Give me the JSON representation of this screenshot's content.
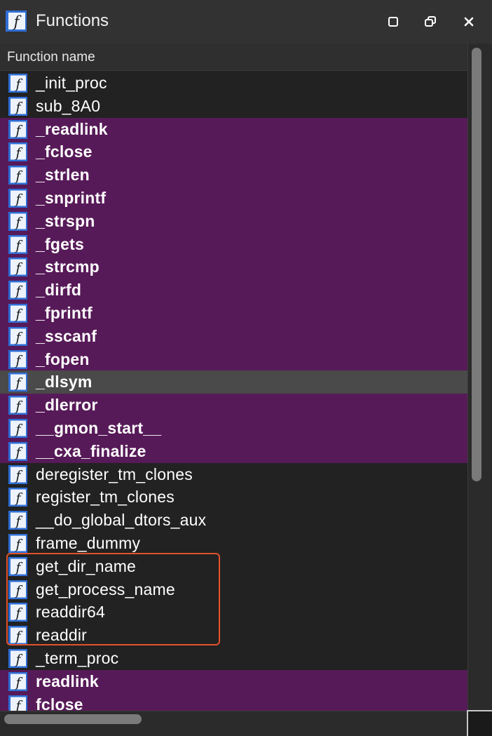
{
  "window": {
    "title": "Functions",
    "icon": "function-icon",
    "controls": [
      "maximize-icon",
      "restore-icon",
      "close-icon"
    ]
  },
  "table": {
    "column_header": "Function name",
    "rows": [
      {
        "name": "_init_proc",
        "style": "plain"
      },
      {
        "name": "sub_8A0",
        "style": "plain"
      },
      {
        "name": "_readlink",
        "style": "import"
      },
      {
        "name": "_fclose",
        "style": "import"
      },
      {
        "name": "_strlen",
        "style": "import"
      },
      {
        "name": "_snprintf",
        "style": "import"
      },
      {
        "name": "_strspn",
        "style": "import"
      },
      {
        "name": "_fgets",
        "style": "import"
      },
      {
        "name": "_strcmp",
        "style": "import"
      },
      {
        "name": "_dirfd",
        "style": "import"
      },
      {
        "name": "_fprintf",
        "style": "import"
      },
      {
        "name": "_sscanf",
        "style": "import"
      },
      {
        "name": "_fopen",
        "style": "import"
      },
      {
        "name": "_dlsym",
        "style": "selected"
      },
      {
        "name": "_dlerror",
        "style": "import"
      },
      {
        "name": "__gmon_start__",
        "style": "import"
      },
      {
        "name": "__cxa_finalize",
        "style": "import"
      },
      {
        "name": "deregister_tm_clones",
        "style": "plain"
      },
      {
        "name": "register_tm_clones",
        "style": "plain"
      },
      {
        "name": "__do_global_dtors_aux",
        "style": "plain"
      },
      {
        "name": "frame_dummy",
        "style": "plain"
      },
      {
        "name": "get_dir_name",
        "style": "plain"
      },
      {
        "name": "get_process_name",
        "style": "plain"
      },
      {
        "name": "readdir64",
        "style": "plain"
      },
      {
        "name": "readdir",
        "style": "plain"
      },
      {
        "name": "_term_proc",
        "style": "plain"
      },
      {
        "name": "readlink",
        "style": "import"
      },
      {
        "name": "fclose",
        "style": "import"
      }
    ]
  },
  "colors": {
    "import_row": "#571a58",
    "selected_row": "#4a4a4a",
    "plain_row": "#222222",
    "highlight_border": "#e2532a",
    "icon_blue": "#2f6fd6"
  }
}
